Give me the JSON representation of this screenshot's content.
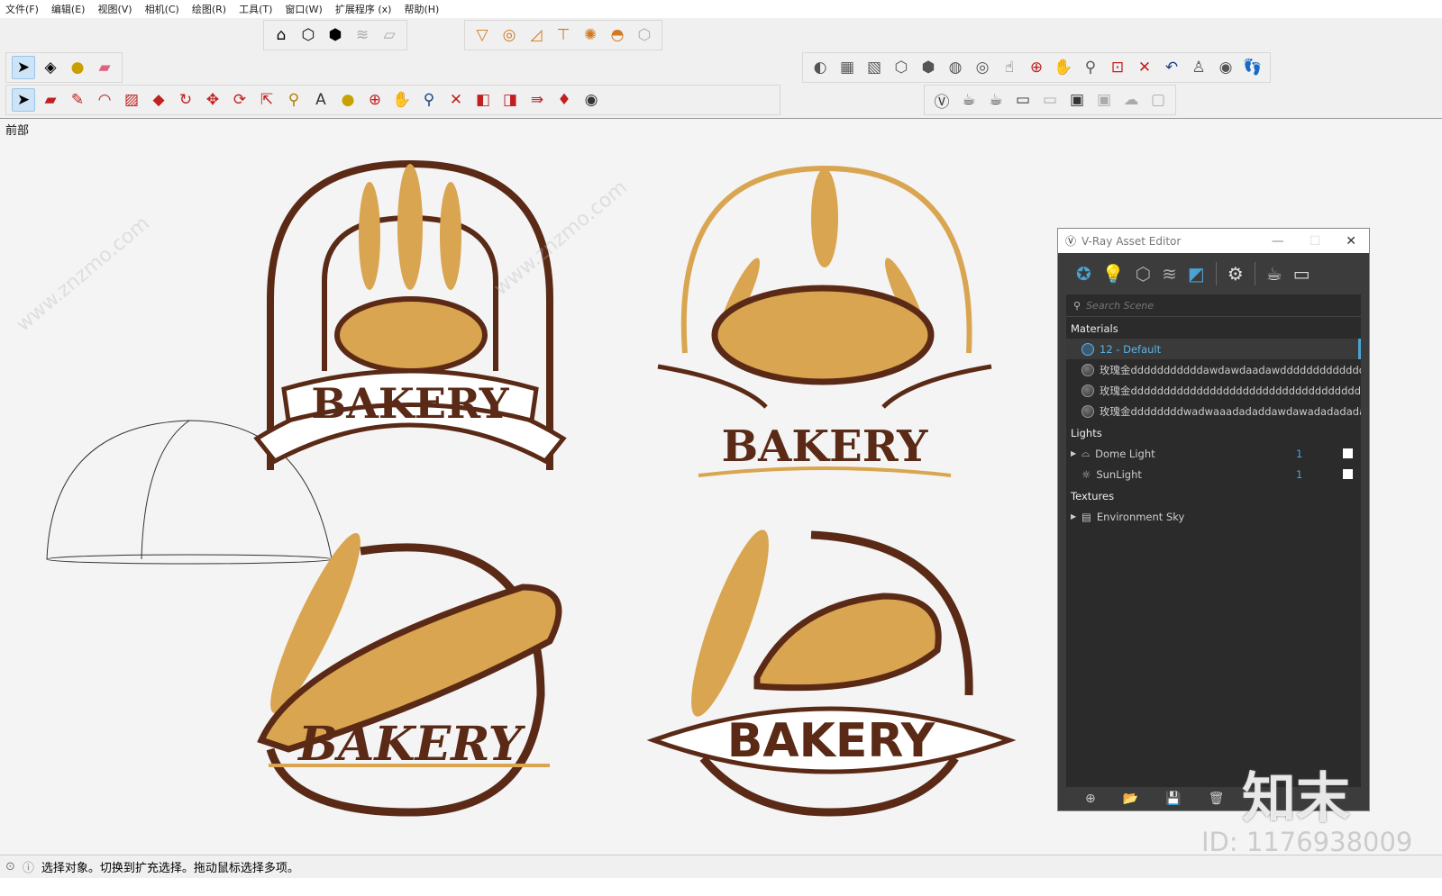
{
  "menu": [
    "文件(F)",
    "编辑(E)",
    "视图(V)",
    "相机(C)",
    "绘图(R)",
    "工具(T)",
    "窗口(W)",
    "扩展程序 (x)",
    "帮助(H)"
  ],
  "viewport": {
    "label": "前部",
    "logos": [
      {
        "text": "BAKERY"
      },
      {
        "text": "BAKERY"
      },
      {
        "text": "BAKERY"
      },
      {
        "text": "BAKERY"
      }
    ]
  },
  "status": {
    "message": "选择对象。切换到扩充选择。拖动鼠标选择多项。"
  },
  "vray": {
    "title": "V-Ray Asset Editor",
    "search_placeholder": "Search Scene",
    "sections": {
      "materials": "Materials",
      "lights": "Lights",
      "textures": "Textures"
    },
    "materials": [
      "12 - Default",
      "玫瑰金dddddddddddawdawdaadawdddddddddddddd...",
      "玫瑰金dddddddddddddddddddddddddddddddddddd...",
      "玫瑰金ddddddddwadwaaadadaddawdawadadadadad..."
    ],
    "lights": [
      {
        "name": "Dome Light",
        "count": "1"
      },
      {
        "name": "SunLight",
        "count": "1"
      }
    ],
    "textures": [
      "Environment Sky"
    ]
  },
  "watermark": {
    "logo": "知末",
    "id": "ID: 1176938009",
    "site": "www.znzmo.com"
  },
  "colors": {
    "brown": "#5a2a16",
    "gold": "#d9a550",
    "vray_accent": "#4aa3d0"
  }
}
